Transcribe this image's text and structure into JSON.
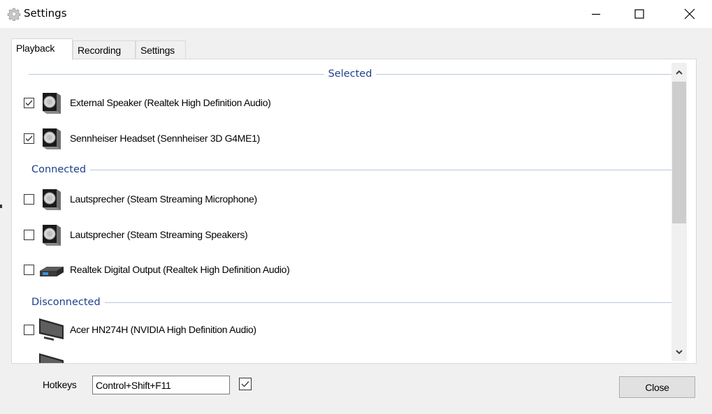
{
  "window": {
    "title": "Settings",
    "icon": "gear-icon",
    "controls": [
      "minimize",
      "maximize",
      "close"
    ]
  },
  "tabs": [
    {
      "label": "Playback",
      "active": true
    },
    {
      "label": "Recording",
      "active": false
    },
    {
      "label": "Settings",
      "active": false
    }
  ],
  "groups": {
    "selected": "Selected",
    "connected": "Connected",
    "disconnected": "Disconnected"
  },
  "devices": [
    {
      "label": "External Speaker (Realtek High Definition Audio)",
      "checked": true,
      "icon": "speaker-icon",
      "group": "selected"
    },
    {
      "label": "Sennheiser Headset (Sennheiser 3D G4ME1)",
      "checked": true,
      "icon": "speaker-icon",
      "group": "selected"
    },
    {
      "label": "Lautsprecher (Steam Streaming Microphone)",
      "checked": false,
      "icon": "speaker-icon",
      "group": "connected"
    },
    {
      "label": "Lautsprecher (Steam Streaming Speakers)",
      "checked": false,
      "icon": "speaker-icon",
      "group": "connected"
    },
    {
      "label": "Realtek Digital Output (Realtek High Definition Audio)",
      "checked": false,
      "icon": "digital-output-icon",
      "group": "connected"
    },
    {
      "label": "Acer HN274H (NVIDIA High Definition Audio)",
      "checked": false,
      "icon": "monitor-icon",
      "group": "disconnected"
    }
  ],
  "footer": {
    "hotkeys_label": "Hotkeys",
    "hotkeys_value": "Control+Shift+F11",
    "hotkeys_enabled": true,
    "close_label": "Close"
  },
  "colors": {
    "group_header": "#1d3f8d",
    "group_line": "#b9c6dd",
    "scroll_thumb": "#cdcdcd"
  }
}
